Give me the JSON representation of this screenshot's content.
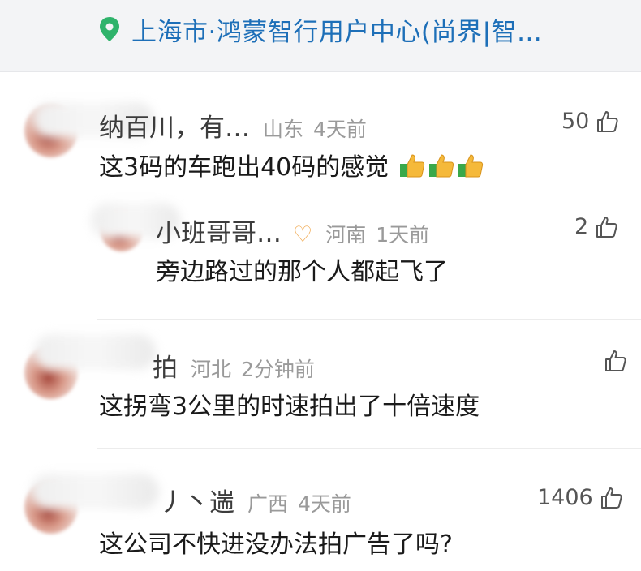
{
  "location": {
    "text": "上海市·鸿蒙智行用户中心(尚界|智…",
    "icon": "location-pin-icon"
  },
  "comments": [
    {
      "name": "纳百川，有…",
      "region": "山东",
      "time": "4天前",
      "likes": "50",
      "text": "这3码的车跑出40码的感觉",
      "emojis": [
        "thumbs-up-emoji",
        "thumbs-up-emoji",
        "thumbs-up-emoji"
      ]
    },
    {
      "name": "小班哥哥…",
      "badge": "♡",
      "region": "河南",
      "time": "1天前",
      "likes": "2",
      "text": "旁边路过的那个人都起飞了"
    },
    {
      "name": "拍",
      "region": "河北",
      "time": "2分钟前",
      "likes": "",
      "text": "这拐弯3公里的时速拍出了十倍速度"
    },
    {
      "name": "丿丶遄",
      "region": "广西",
      "time": "4天前",
      "likes": "1406",
      "text": "这公司不快进没办法拍广告了吗?"
    }
  ],
  "colors": {
    "location": "#1d6fb8",
    "pin": "#2fb36b",
    "meta": "#9a9a9a",
    "badge": "#f0a64a"
  }
}
